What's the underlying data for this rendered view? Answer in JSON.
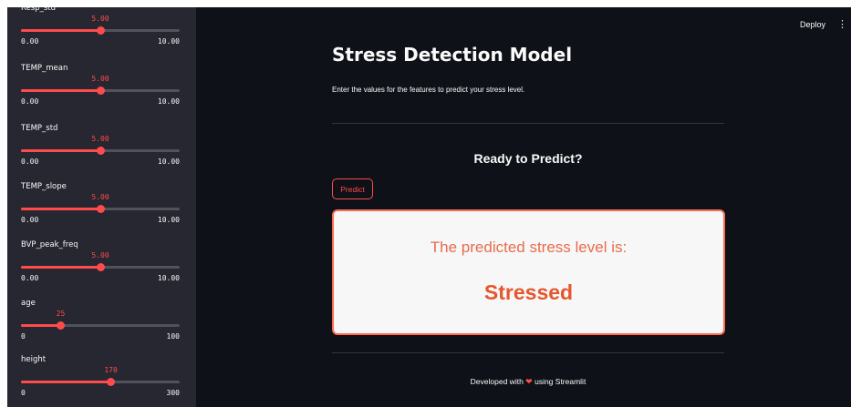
{
  "sidebar": {
    "sliders": [
      {
        "label": "Resp_std",
        "value": "5.00",
        "min": "0.00",
        "max": "10.00",
        "fraction": 0.5
      },
      {
        "label": "TEMP_mean",
        "value": "5.00",
        "min": "0.00",
        "max": "10.00",
        "fraction": 0.5
      },
      {
        "label": "TEMP_std",
        "value": "5.00",
        "min": "0.00",
        "max": "10.00",
        "fraction": 0.5
      },
      {
        "label": "TEMP_slope",
        "value": "5.00",
        "min": "0.00",
        "max": "10.00",
        "fraction": 0.5
      },
      {
        "label": "BVP_peak_freq",
        "value": "5.00",
        "min": "0.00",
        "max": "10.00",
        "fraction": 0.5
      },
      {
        "label": "age",
        "value": "25",
        "min": "0",
        "max": "100",
        "fraction": 0.25
      },
      {
        "label": "height",
        "value": "170",
        "min": "0",
        "max": "300",
        "fraction": 0.5667
      }
    ]
  },
  "header": {
    "deploy_label": "Deploy",
    "menu_icon": "kebab-menu-icon"
  },
  "main": {
    "title": "Stress Detection Model",
    "subtitle": "Enter the values for the features to predict your stress level.",
    "section_heading": "Ready to Predict?",
    "predict_label": "Predict",
    "result_caption": "The predicted stress level is:",
    "result_value": "Stressed"
  },
  "footer": {
    "prefix": "Developed with",
    "heart_icon": "heart-icon",
    "suffix": "using Streamlit"
  },
  "colors": {
    "accent": "#ff4b4b",
    "background": "#0e1117",
    "sidebar": "#262730",
    "result_text": "#e4572e"
  }
}
